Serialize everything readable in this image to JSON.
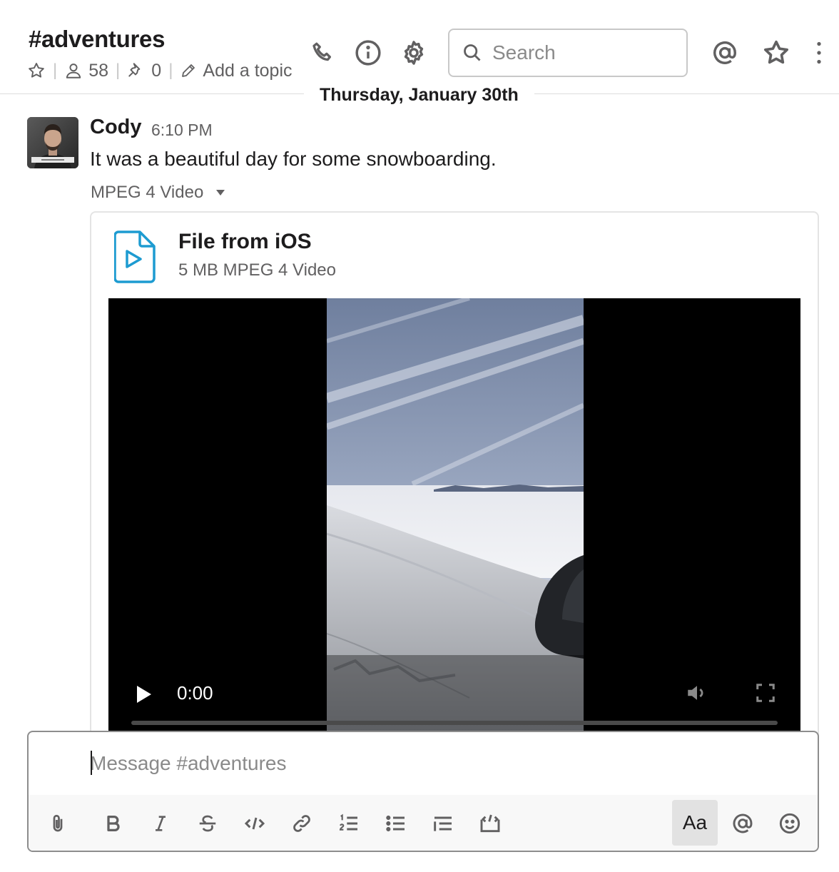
{
  "header": {
    "channel_name": "#adventures",
    "members_count": "58",
    "pinned_count": "0",
    "add_topic_label": "Add a topic",
    "search_placeholder": "Search"
  },
  "date_divider": "Thursday, January 30th",
  "message": {
    "sender": "Cody",
    "time": "6:10 PM",
    "text": "It was a beautiful day for some snowboarding.",
    "attachment_type": "MPEG 4 Video",
    "file": {
      "name": "File from iOS",
      "subtitle": "5 MB MPEG 4 Video"
    },
    "video": {
      "current_time": "0:00",
      "progress": 0
    }
  },
  "composer": {
    "placeholder": "Message #adventures",
    "format_button_label": "Aa"
  },
  "colors": {
    "accent_blue": "#1d9bd1",
    "text_primary": "#1d1c1d",
    "text_secondary": "#616061"
  },
  "icons": {
    "header": [
      "phone-icon",
      "info-icon",
      "gear-icon",
      "search-icon",
      "at-sign-icon",
      "star-icon",
      "more-vertical-icon"
    ],
    "toolbar": [
      "paperclip-icon",
      "bold-icon",
      "italic-icon",
      "strikethrough-icon",
      "code-icon",
      "link-icon",
      "ordered-list-icon",
      "bulleted-list-icon",
      "blockquote-icon",
      "code-block-icon",
      "text-format-icon",
      "mention-icon",
      "emoji-icon"
    ]
  }
}
